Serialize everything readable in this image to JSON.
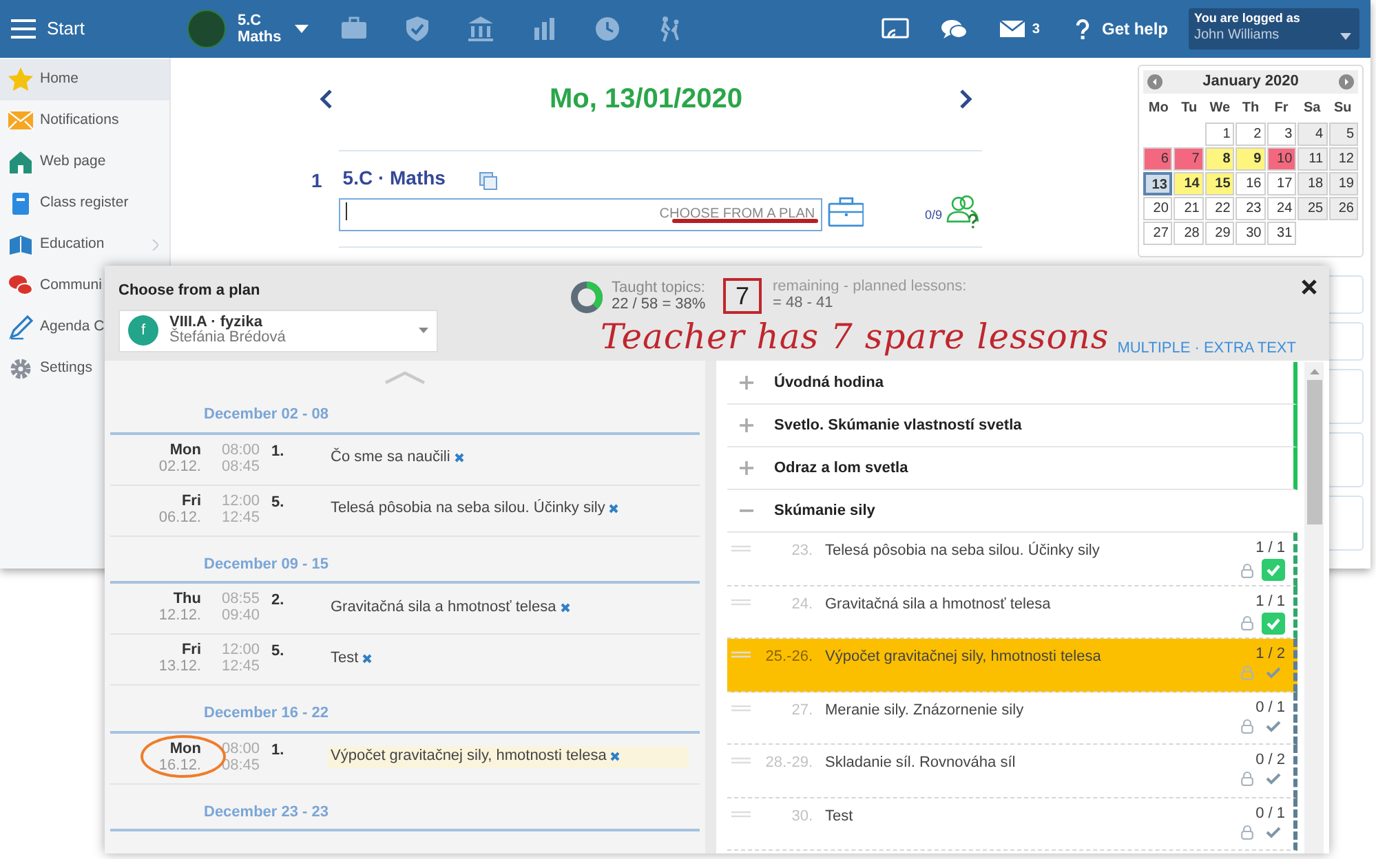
{
  "top_bar": {
    "menu_label": "Start",
    "class_name": "5.C",
    "subject": "Maths",
    "messages_count": "3",
    "help": "Get help",
    "user_caption": "You are logged as",
    "user_name": "John Williams"
  },
  "sidebar": {
    "items": [
      {
        "label": "Home",
        "selected": true,
        "submenu": false
      },
      {
        "label": "Notifications",
        "selected": false,
        "submenu": false
      },
      {
        "label": "Web page",
        "selected": false,
        "submenu": false
      },
      {
        "label": "Class register",
        "selected": false,
        "submenu": false
      },
      {
        "label": "Education",
        "selected": false,
        "submenu": true
      },
      {
        "label": "Communi",
        "selected": false,
        "submenu": false
      },
      {
        "label": "Agenda C",
        "selected": false,
        "submenu": false
      },
      {
        "label": "Settings",
        "selected": false,
        "submenu": false
      }
    ]
  },
  "day": {
    "title": "Mo, 13/01/2020"
  },
  "lessons": [
    {
      "number": "1",
      "title": "5.C · Maths",
      "placeholder": "CHOOSE FROM A PLAN",
      "underlined": true,
      "attendance": "0/9"
    }
  ],
  "calendar": {
    "title": "January 2020",
    "weekdays": [
      "Mo",
      "Tu",
      "We",
      "Th",
      "Fr",
      "Sa",
      "Su"
    ],
    "weeks": [
      [
        {
          "day": "1"
        },
        {
          "day": "2"
        },
        {
          "day": "3"
        },
        {
          "day": "4",
          "weekend": true
        },
        {
          "day": "5",
          "weekend": true
        }
      ],
      [
        {
          "day": "6",
          "color": "#f4687f"
        },
        {
          "day": "7",
          "color": "#f4687f"
        },
        {
          "day": "8",
          "color": "#fdf57e"
        },
        {
          "day": "9",
          "color": "#fdf57e"
        },
        {
          "day": "10",
          "color": "#f4687f"
        },
        {
          "day": "11",
          "weekend": true
        },
        {
          "day": "12",
          "weekend": true
        }
      ],
      [
        {
          "day": "13",
          "selected": true
        },
        {
          "day": "14",
          "color": "#fdf57e"
        },
        {
          "day": "15",
          "color": "#fdf57e"
        },
        {
          "day": "16"
        },
        {
          "day": "17"
        },
        {
          "day": "18",
          "weekend": true
        },
        {
          "day": "19",
          "weekend": true
        }
      ],
      [
        {
          "day": "20"
        },
        {
          "day": "21"
        },
        {
          "day": "22"
        },
        {
          "day": "23"
        },
        {
          "day": "24"
        },
        {
          "day": "25",
          "weekend": true
        },
        {
          "day": "26",
          "weekend": true
        }
      ],
      [
        {
          "day": "27"
        },
        {
          "day": "28"
        },
        {
          "day": "29"
        },
        {
          "day": "30"
        },
        {
          "day": "31"
        }
      ]
    ]
  },
  "popup": {
    "title": "Choose from a plan",
    "plan": {
      "avatar": "f",
      "name": "VIII.A · fyzika",
      "teacher": "Štefánia Brédová"
    },
    "taught": {
      "label": "Taught topics:",
      "value": "22 / 58 = 38%",
      "level": 0.38
    },
    "remaining": {
      "count": "7",
      "boxed": true,
      "label": "remaining - planned lessons:",
      "value": "= 48 - 41"
    },
    "annotation": "Teacher has 7 spare lessons",
    "actions": "MULTIPLE · EXTRA TEXT",
    "schedule": [
      {
        "week": "December 02 - 08",
        "lessons": [
          {
            "day": "Mon",
            "date": "02.12.",
            "start": "08:00",
            "end": "08:45",
            "period": "1.",
            "topic": "Čo sme sa naučili",
            "selected": false,
            "circled": false
          },
          {
            "day": "Fri",
            "date": "06.12.",
            "start": "12:00",
            "end": "12:45",
            "period": "5.",
            "topic": "Telesá pôsobia na seba silou. Účinky sily",
            "selected": false,
            "circled": false
          }
        ]
      },
      {
        "week": "December 09 - 15",
        "lessons": [
          {
            "day": "Thu",
            "date": "12.12.",
            "start": "08:55",
            "end": "09:40",
            "period": "2.",
            "topic": "Gravitačná sila a hmotnosť telesa",
            "selected": false,
            "circled": false
          },
          {
            "day": "Fri",
            "date": "13.12.",
            "start": "12:00",
            "end": "12:45",
            "period": "5.",
            "topic": "Test",
            "selected": false,
            "circled": false
          }
        ]
      },
      {
        "week": "December 16 - 22",
        "lessons": [
          {
            "day": "Mon",
            "date": "16.12.",
            "start": "08:00",
            "end": "08:45",
            "period": "1.",
            "topic": "Výpočet gravitačnej sily, hmotnosti telesa",
            "selected": true,
            "circled": true
          }
        ]
      },
      {
        "week": "December 23 - 23"
      }
    ],
    "topics": [
      {
        "title": "Úvodná hodina",
        "expanded": false
      },
      {
        "title": "Svetlo. Skúmanie vlastností svetla",
        "expanded": false
      },
      {
        "title": "Odraz a lom svetla",
        "expanded": false
      },
      {
        "title": "Skúmanie sily",
        "expanded": true,
        "children": [
          {
            "number": "23.",
            "title": "Telesá pôsobia na seba silou. Účinky sily",
            "count": "1 / 1",
            "done": true,
            "selected": false
          },
          {
            "number": "24.",
            "title": "Gravitačná sila a hmotnosť telesa",
            "count": "1 / 1",
            "done": true,
            "selected": false
          },
          {
            "number": "25.-26.",
            "title": "Výpočet gravitačnej sily, hmotnosti telesa",
            "count": "1 / 2",
            "done": false,
            "selected": true
          },
          {
            "number": "27.",
            "title": "Meranie sily. Znázornenie sily",
            "count": "0 / 1",
            "done": false,
            "selected": false
          },
          {
            "number": "28.-29.",
            "title": "Skladanie síl. Rovnováha síl",
            "count": "0 / 2",
            "done": false,
            "selected": false
          },
          {
            "number": "30.",
            "title": "Test",
            "count": "0 / 1",
            "done": false,
            "selected": false
          }
        ]
      }
    ]
  }
}
